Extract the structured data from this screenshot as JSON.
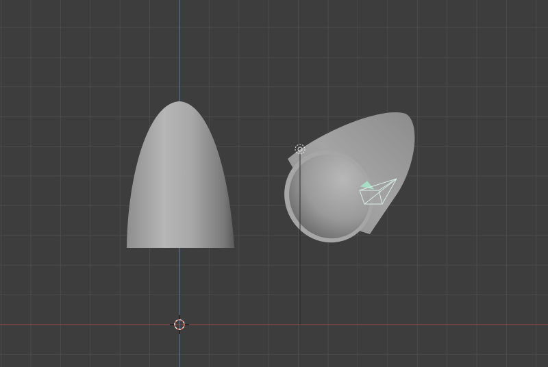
{
  "viewport": {
    "view": "3d-viewport-front-orthographic",
    "colors": {
      "background": "#3d3d3d",
      "grid": "#4b4b4b",
      "x_axis": "#9a4a4a",
      "z_axis": "#5a7aa0",
      "mesh": "#b0b0b0",
      "camera": "#b8e0d0",
      "light": "#e6e6e6",
      "cursor": "#e07060"
    },
    "objects": [
      {
        "name": "bullet-shape",
        "icon": "mesh-object"
      },
      {
        "name": "hollow-shell",
        "icon": "mesh-object"
      },
      {
        "name": "camera",
        "icon": "camera-icon"
      },
      {
        "name": "light",
        "icon": "light-icon"
      },
      {
        "name": "3d-cursor",
        "icon": "3d-cursor-icon"
      }
    ]
  }
}
